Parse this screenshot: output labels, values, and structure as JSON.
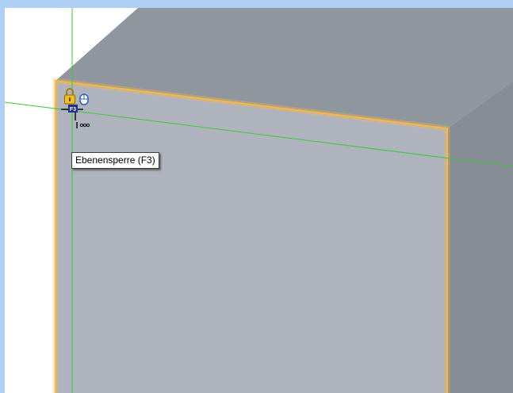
{
  "viewport": {
    "background": "#ffffff",
    "frame_color": "#aed0f4"
  },
  "model": {
    "front_face_color": "#aeb3bd",
    "top_face_color": "#8f969d",
    "side_face_color": "#868d97",
    "selected_edge_color": "#f4b848",
    "guide_line_color": "#38c838"
  },
  "cursor": {
    "icons": [
      "lock-icon",
      "mouse-icon",
      "f3-key-badge",
      "more-options-icon"
    ],
    "key_label": "F3"
  },
  "tooltip": {
    "text": "Ebenensperre (F3)"
  }
}
